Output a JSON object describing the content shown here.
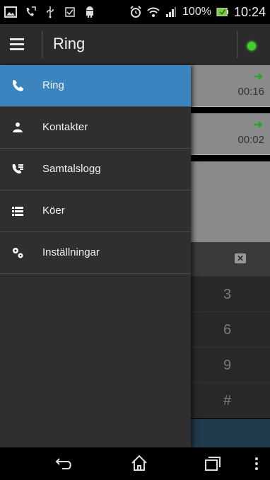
{
  "status_bar": {
    "battery_percent": "100%",
    "time": "10:24",
    "icons": [
      "image-icon",
      "call-forward-icon",
      "usb-icon",
      "checkbox-icon",
      "android-icon",
      "alarm-icon",
      "wifi-icon",
      "signal-icon",
      "battery-icon"
    ]
  },
  "action_bar": {
    "title": "Ring",
    "status_color": "#3fd12a"
  },
  "drawer": {
    "items": [
      {
        "label": "Ring",
        "icon": "phone-icon",
        "active": true
      },
      {
        "label": "Kontakter",
        "icon": "person-icon",
        "active": false
      },
      {
        "label": "Samtalslogg",
        "icon": "call-log-icon",
        "active": false
      },
      {
        "label": "Köer",
        "icon": "list-icon",
        "active": false
      },
      {
        "label": "Inställningar",
        "icon": "settings-icon",
        "active": false
      }
    ],
    "accent": "#3a85c0"
  },
  "background": {
    "calls": [
      {
        "duration": "00:16",
        "icon": "arrow-right-icon"
      },
      {
        "duration": "00:02",
        "icon": "arrow-right-icon"
      }
    ],
    "keypad_digits": [
      "3",
      "6",
      "9",
      "#"
    ]
  },
  "nav_bar": {
    "icons": [
      "back-icon",
      "home-icon",
      "recents-icon",
      "menu-icon"
    ]
  }
}
